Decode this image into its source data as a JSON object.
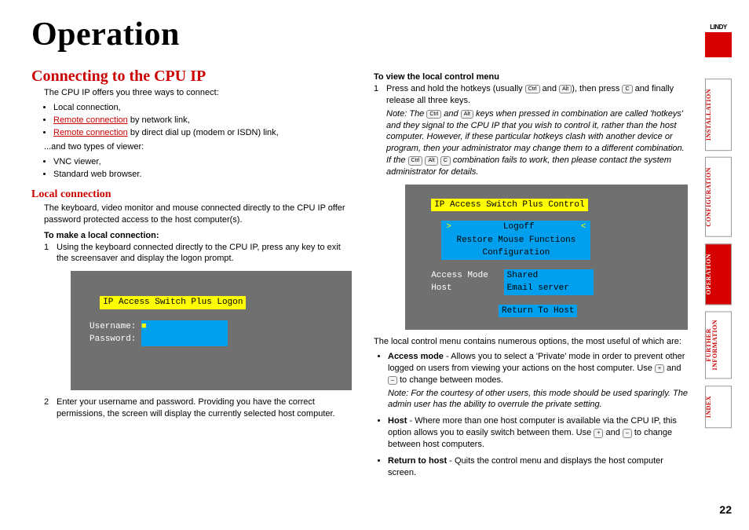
{
  "title": "Operation",
  "heading1": "Connecting to the CPU IP",
  "intro": "The CPU IP offers you three ways to connect:",
  "conn_bullets": {
    "b1": "Local connection,",
    "b2_link": "Remote connection",
    "b2_rest": " by network link,",
    "b3_link": "Remote connection",
    "b3_rest": " by direct dial up (modem or ISDN) link,"
  },
  "intro2": "...and two types of viewer:",
  "viewer_bullets": {
    "v1": "VNC viewer,",
    "v2": "Standard web browser."
  },
  "local_heading": "Local connection",
  "local_p": "The keyboard, video monitor and mouse connected directly to the CPU IP offer password protected access to the host computer(s).",
  "make_local": "To make a local connection:",
  "ml_step1": "Using the keyboard connected directly to the CPU IP, press any key to exit the screensaver and display the logon prompt.",
  "ml_step2": "Enter your username and password. Providing you have the correct permissions, the screen will display the currently selected host computer.",
  "logon_box": {
    "title": "IP Access Switch Plus Logon",
    "user_label": "Username:",
    "pwd_label": "Password:"
  },
  "view_menu_h": "To view the local control menu",
  "vm_step1_a": "Press and hold the hotkeys (usually ",
  "vm_step1_b": " and ",
  "vm_step1_c": "), then press ",
  "vm_step1_d": " and finally release all three keys.",
  "vm_note_a": "Note: The ",
  "vm_note_b": " and ",
  "vm_note_c": " keys when pressed in combination are called 'hotkeys' and they signal to the CPU IP that you wish to control it, rather than the host computer. However, if these particular hotkeys clash with another device or program, then your administrator may change them to a different combination. If the ",
  "vm_note_d": " combination fails to work, then please contact the system administrator for details.",
  "ctrl_box": {
    "title": "IP Access Switch Plus Control",
    "logoff": "Logoff",
    "restore": "Restore Mouse Functions",
    "config": "Configuration",
    "access_label": "Access Mode",
    "access_val": "Shared",
    "host_label": "Host",
    "host_val": "Email server",
    "return": "Return To Host"
  },
  "post_p": "The local control menu contains numerous options, the most useful of which are:",
  "post": {
    "access_b": "Access mode",
    "access_t1": " - Allows you to select a 'Private' mode in order to prevent other logged on users from viewing your actions on the host computer. Use ",
    "access_t2": " and ",
    "access_t3": " to change between modes.",
    "access_note": "Note: For the courtesy of other users, this mode should be used sparingly. The admin user has the ability to overrule the private setting.",
    "host_b": "Host",
    "host_t1": " - Where more than one host computer is available via the CPU IP, this option allows you to easily switch between them. Use ",
    "host_t2": " and ",
    "host_t3": " to change between host computers.",
    "return_b": "Return to host",
    "return_t": " - Quits the control menu and displays the host computer screen."
  },
  "keys": {
    "ctrl": "Ctrl",
    "alt": "Alt",
    "c": "C",
    "plus": "+",
    "minus": "–"
  },
  "tabs": {
    "t1": "INSTALLATION",
    "t2": "CONFIGURATION",
    "t3": "OPERATION",
    "t4a": "FURTHER",
    "t4b": "INFORMATION",
    "t5": "INDEX"
  },
  "logo": "LINDY",
  "page_num": "22"
}
